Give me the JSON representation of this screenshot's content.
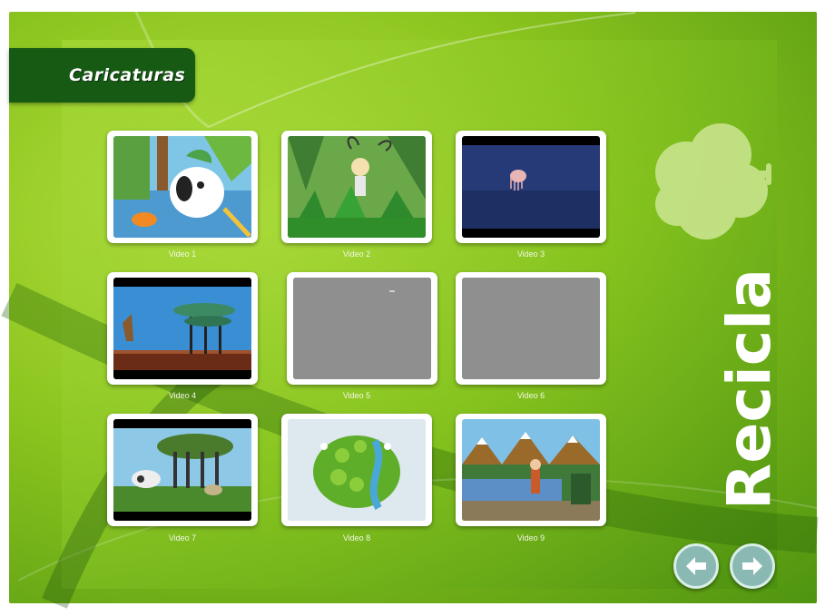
{
  "header": {
    "title": "Caricaturas"
  },
  "logo": {
    "text": "Recicla"
  },
  "videos": [
    {
      "label": "Video 1"
    },
    {
      "label": "Video 2"
    },
    {
      "label": "Video 3"
    },
    {
      "label": "Video 4"
    },
    {
      "label": "Video 5"
    },
    {
      "label": "Video 6"
    },
    {
      "label": "Video 7"
    },
    {
      "label": "Video 8"
    },
    {
      "label": "Video 9"
    }
  ],
  "navigation": {
    "prev_icon": "arrow-left-icon",
    "next_icon": "arrow-right-icon"
  },
  "colors": {
    "frame_green": "#8cc51f",
    "title_tab": "#165a14",
    "nav_button": "#8ab8b2"
  }
}
